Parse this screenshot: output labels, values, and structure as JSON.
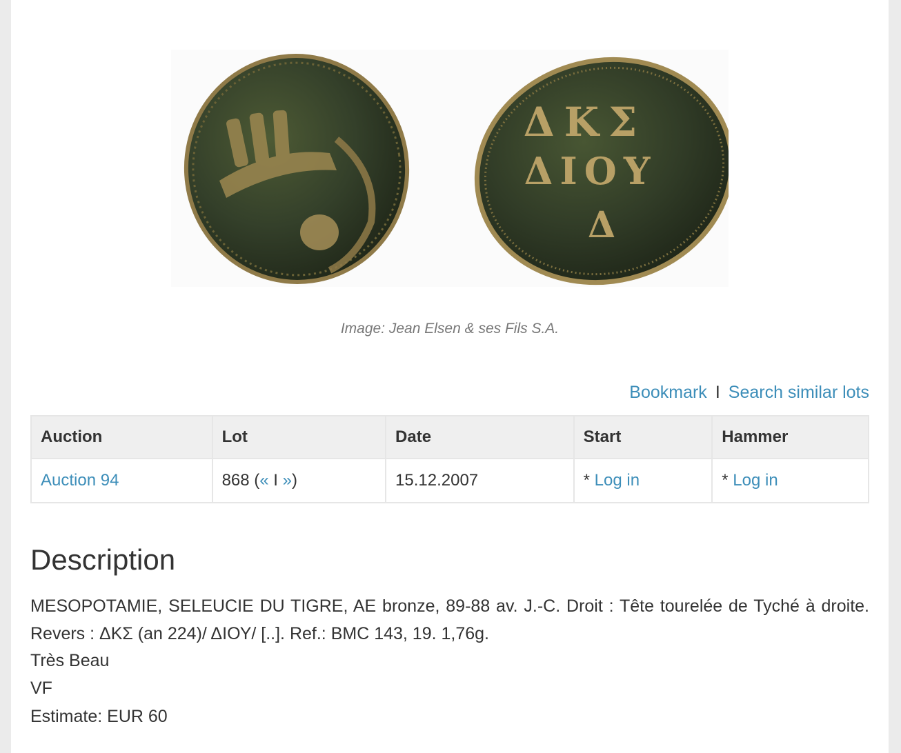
{
  "image": {
    "caption": "Image: Jean Elsen & ses Fils S.A.",
    "reverse_legend": [
      "ΔΚΣ",
      "ΔΙΟΥ",
      "Δ"
    ]
  },
  "actions": {
    "bookmark": "Bookmark",
    "separator": "I",
    "search_similar": "Search similar lots"
  },
  "table": {
    "headers": [
      "Auction",
      "Lot",
      "Date",
      "Start",
      "Hammer"
    ],
    "row": {
      "auction": "Auction 94",
      "lot_number": "868",
      "lot_open": " (",
      "prev": "«",
      "nav_sep": " I ",
      "next": "»",
      "lot_close": ")",
      "date": "15.12.2007",
      "start_prefix": "* ",
      "start_link": "Log in",
      "hammer_prefix": "* ",
      "hammer_link": "Log in"
    }
  },
  "description": {
    "title": "Description",
    "text": "MESOPOTAMIE, SELEUCIE DU TIGRE, AE bronze, 89-88 av. J.-C. Droit : Tête tourelée de Tyché à droite. Revers : ΔΚΣ (an 224)/ ΔΙΟΥ/ [..]. Ref.: BMC 143, 19. 1,76g.",
    "grade_fr": "Très Beau",
    "grade_en": "VF",
    "estimate": "Estimate: EUR 60"
  },
  "colors": {
    "link": "#3d8eb9",
    "coin_dark": "#2f3a24",
    "coin_highlight": "#b49a5e"
  }
}
